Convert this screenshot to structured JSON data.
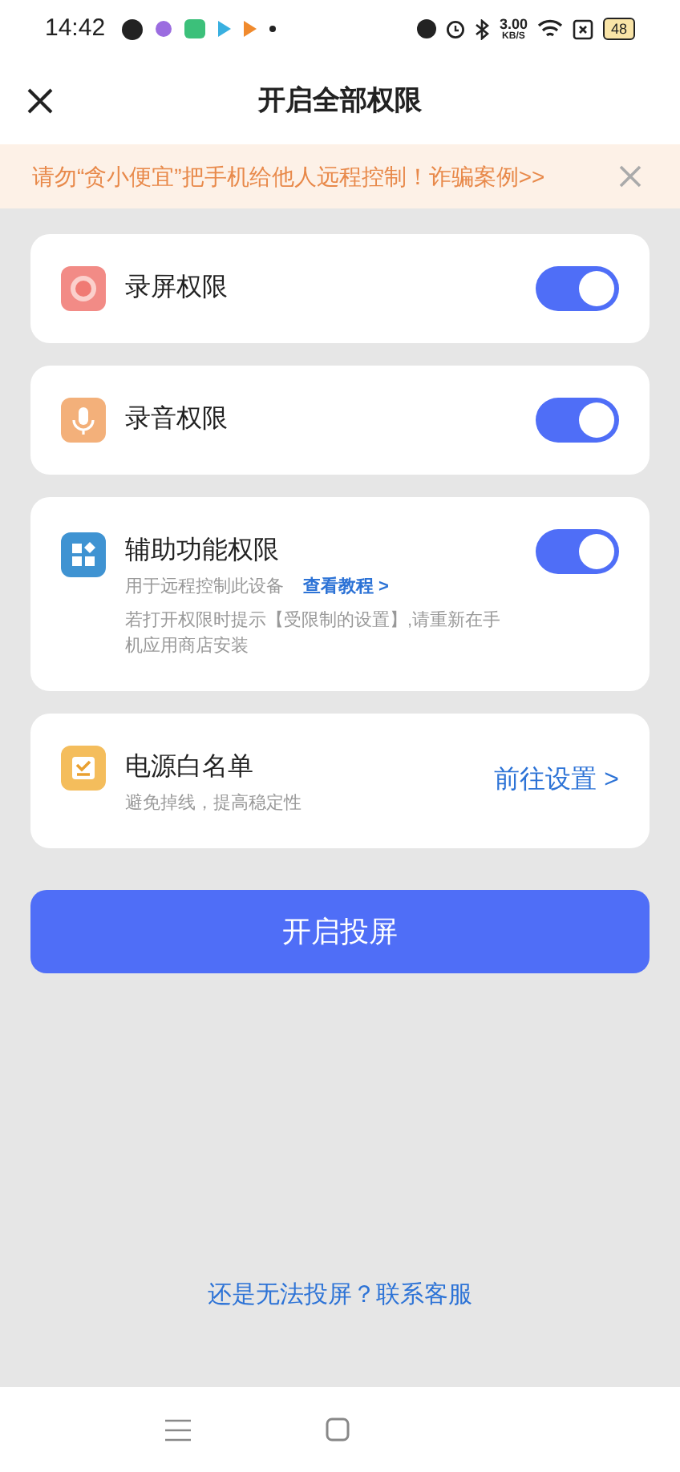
{
  "status_bar": {
    "time": "14:42",
    "speed_value": "3.00",
    "speed_unit": "KB/S",
    "battery": "48"
  },
  "header": {
    "title": "开启全部权限"
  },
  "notice": {
    "text": "请勿“贪小便宜”把手机给他人远程控制！诈骗案例>>"
  },
  "permissions": [
    {
      "kind": "toggle",
      "title": "录屏权限",
      "on": true
    },
    {
      "kind": "toggle",
      "title": "录音权限",
      "on": true
    },
    {
      "kind": "toggle",
      "title": "辅助功能权限",
      "subtitle": "用于远程控制此设备",
      "link": "查看教程 >",
      "note": "若打开权限时提示【受限制的设置】,请重新在手机应用商店安装",
      "on": true
    },
    {
      "kind": "link",
      "title": "电源白名单",
      "subtitle": "避免掉线，提高稳定性",
      "link": "前往设置 >"
    }
  ],
  "primary_button": "开启投屏",
  "help_link": "还是无法投屏？联系客服"
}
